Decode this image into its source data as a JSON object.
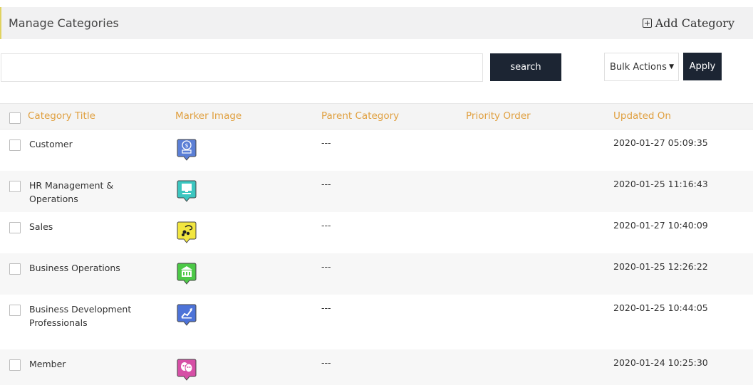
{
  "header": {
    "title": "Manage Categories",
    "add_label": "Add Category"
  },
  "toolbar": {
    "search_value": "",
    "search_placeholder": "",
    "search_label": "search",
    "bulk_selected": "Bulk Actions",
    "apply_label": "Apply"
  },
  "table": {
    "columns": {
      "title": "Category Title",
      "marker": "Marker Image",
      "parent": "Parent Category",
      "priority": "Priority Order",
      "updated": "Updated On"
    },
    "rows": [
      {
        "title": "Customer",
        "parent": "---",
        "priority": "",
        "updated": "2020-01-27 05:09:35",
        "marker_icon": "customer-service-marker",
        "marker_color": "#5b7fd6"
      },
      {
        "title": "HR Management & Operations",
        "parent": "---",
        "priority": "",
        "updated": "2020-01-25 11:16:43",
        "marker_icon": "computer-marker",
        "marker_color": "#3cc6c0"
      },
      {
        "title": "Sales",
        "parent": "---",
        "priority": "",
        "updated": "2020-01-27 10:40:09",
        "marker_icon": "sales-marker",
        "marker_color": "#f2e640"
      },
      {
        "title": "Business Operations",
        "parent": "---",
        "priority": "",
        "updated": "2020-01-25 12:26:22",
        "marker_icon": "building-marker",
        "marker_color": "#4cc947"
      },
      {
        "title": "Business Development Professionals",
        "parent": "---",
        "priority": "",
        "updated": "2020-01-25 10:44:05",
        "marker_icon": "chart-growth-marker",
        "marker_color": "#4d73d8"
      },
      {
        "title": "Member",
        "parent": "---",
        "priority": "",
        "updated": "2020-01-24 10:25:30",
        "marker_icon": "theater-masks-marker",
        "marker_color": "#d64fa6"
      }
    ]
  }
}
